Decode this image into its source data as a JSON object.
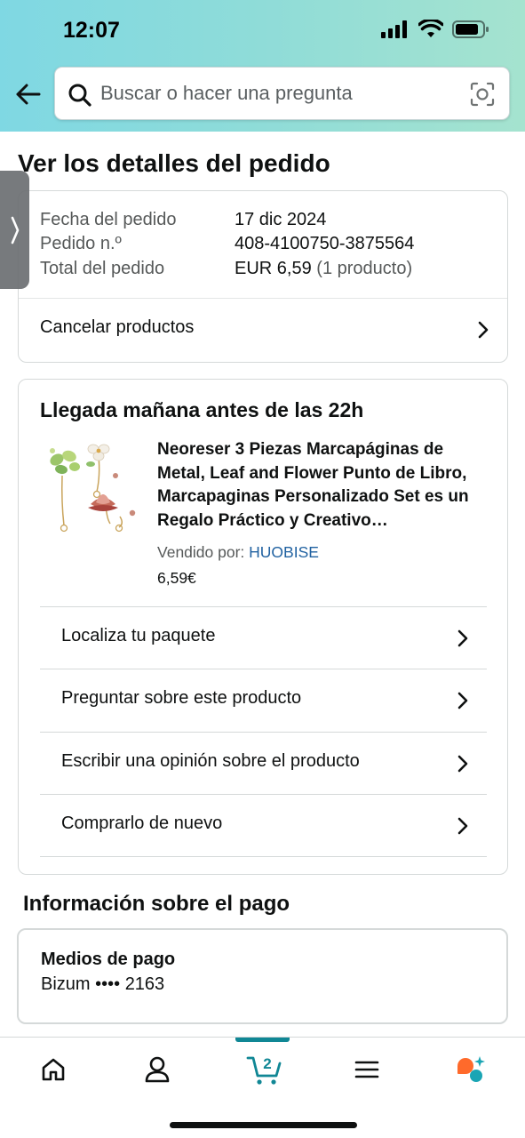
{
  "status_bar": {
    "time": "12:07"
  },
  "search": {
    "placeholder": "Buscar o hacer una pregunta"
  },
  "page": {
    "title": "Ver los detalles del pedido"
  },
  "order": {
    "date_label": "Fecha del pedido",
    "date_value": "17 dic 2024",
    "number_label": "Pedido n.º",
    "number_value": "408-4100750-3875564",
    "total_label": "Total del pedido",
    "total_value": "EUR 6,59",
    "total_count": "(1 producto)",
    "cancel_label": "Cancelar productos"
  },
  "delivery": {
    "title": "Llegada mañana antes de las 22h",
    "product": {
      "title": "Neoreser 3 Piezas Marcapáginas de Metal, Leaf and Flower Punto de Libro, Marcapaginas Personalizado Set es un Regalo Práctico y Creativo…",
      "sold_by_label": "Vendido por:",
      "seller": "HUOBISE",
      "price": "6,59€"
    },
    "actions": [
      {
        "label": "Localiza tu paquete"
      },
      {
        "label": "Preguntar sobre este producto"
      },
      {
        "label": "Escribir una opinión sobre el producto"
      },
      {
        "label": "Comprarlo de nuevo"
      }
    ]
  },
  "payment": {
    "heading": "Información sobre el pago",
    "methods_label": "Medios de pago",
    "method_value": "Bizum •••• 2163"
  },
  "bottom_nav": {
    "cart_count": "2",
    "items": [
      "home-icon",
      "account-icon",
      "cart-icon",
      "menu-icon",
      "rufus-assistant-icon"
    ],
    "active": "cart"
  },
  "colors": {
    "header_gradient_start": "#7fd8e3",
    "header_gradient_end": "#a5e3cf",
    "link": "#2162a1",
    "nav_active": "#108795",
    "assistant_orange": "#ff6a2b",
    "assistant_teal": "#1aa5b4"
  }
}
